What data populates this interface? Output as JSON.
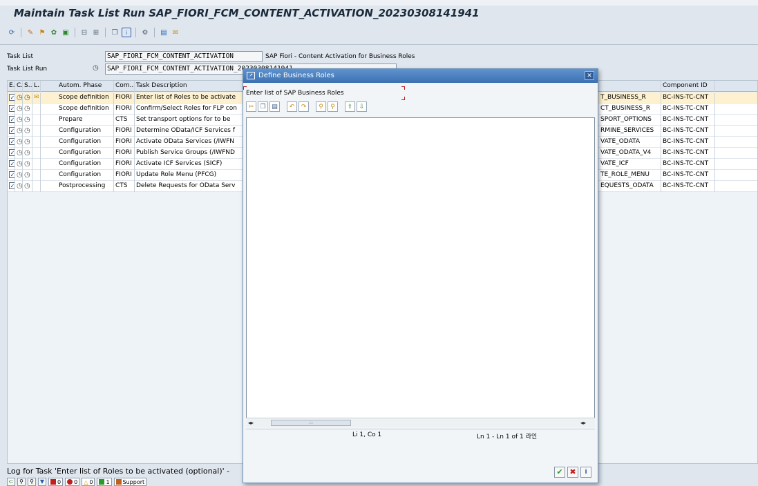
{
  "page": {
    "title": "Maintain Task List Run SAP_FIORI_FCM_CONTENT_ACTIVATION_20230308141941"
  },
  "toolbar": {
    "icons": [
      "refresh-icon",
      "execute-icon",
      "step-icon",
      "tools-icon",
      "monitor-icon",
      "export-icon",
      "import-icon",
      "copy-icon",
      "info-icon",
      "settings-icon",
      "display-icon",
      "log-icon"
    ]
  },
  "header": {
    "task_list_label": "Task List",
    "task_list_value": "SAP_FIORI_FCM_CONTENT_ACTIVATION",
    "task_list_desc": "SAP Fiori - Content Activation for Business Roles",
    "task_list_run_label": "Task List Run",
    "task_list_run_value": "SAP_FIORI_FCM_CONTENT_ACTIVATION_20230308141941"
  },
  "grid": {
    "columns": [
      "E...",
      "C...",
      "S...",
      "L...",
      "Autom. Phase",
      "Com...",
      "Task Description",
      "Component ID"
    ],
    "rows": [
      {
        "phase": "Scope definition",
        "comp": "FIORI",
        "desc": "Enter list of Roles to be activate",
        "tech": "T_BUSINESS_R",
        "compid": "BC-INS-TC-CNT",
        "selected": true,
        "log": true
      },
      {
        "phase": "Scope definition",
        "comp": "FIORI",
        "desc": "Confirm/Select Roles for FLP con",
        "tech": "CT_BUSINESS_R",
        "compid": "BC-INS-TC-CNT",
        "selected": false,
        "log": false
      },
      {
        "phase": "Prepare",
        "comp": "CTS",
        "desc": "Set transport options for to be",
        "tech": "SPORT_OPTIONS",
        "compid": "BC-INS-TC-CNT",
        "selected": false,
        "log": false
      },
      {
        "phase": "Configuration",
        "comp": "FIORI",
        "desc": "Determine OData/ICF Services f",
        "tech": "RMINE_SERVICES",
        "compid": "BC-INS-TC-CNT",
        "selected": false,
        "log": false
      },
      {
        "phase": "Configuration",
        "comp": "FIORI",
        "desc": "Activate OData Services (/IWFN",
        "tech": "VATE_ODATA",
        "compid": "BC-INS-TC-CNT",
        "selected": false,
        "log": false
      },
      {
        "phase": "Configuration",
        "comp": "FIORI",
        "desc": "Publish Service Groups (/IWFND",
        "tech": "VATE_ODATA_V4",
        "compid": "BC-INS-TC-CNT",
        "selected": false,
        "log": false
      },
      {
        "phase": "Configuration",
        "comp": "FIORI",
        "desc": "Activate ICF Services (SICF)",
        "tech": "VATE_ICF",
        "compid": "BC-INS-TC-CNT",
        "selected": false,
        "log": false
      },
      {
        "phase": "Configuration",
        "comp": "FIORI",
        "desc": "Update Role Menu (PFCG)",
        "tech": "TE_ROLE_MENU",
        "compid": "BC-INS-TC-CNT",
        "selected": false,
        "log": false
      },
      {
        "phase": "Postprocessing",
        "comp": "CTS",
        "desc": "Delete Requests for OData Serv",
        "tech": "EQUESTS_ODATA",
        "compid": "BC-INS-TC-CNT",
        "selected": false,
        "log": false
      }
    ]
  },
  "dialog": {
    "title": "Define Business Roles",
    "label": "Enter list of SAP Business Roles",
    "status_pos": "Li 1, Co 1",
    "status_lines": "Ln 1 - Ln 1 of 1 라인"
  },
  "bottom": {
    "log_text": "Log for Task 'Enter list of Roles to be activated (optional)' -",
    "count_error": "0",
    "count_stop": "0",
    "count_warn": "0",
    "count_ok": "1",
    "support_label": "Support"
  },
  "colors": {
    "selected_row": "#fdf1cf",
    "dialog_title": "#3c70b0",
    "accept": "#2a9a2a",
    "cancel": "#c02020"
  }
}
